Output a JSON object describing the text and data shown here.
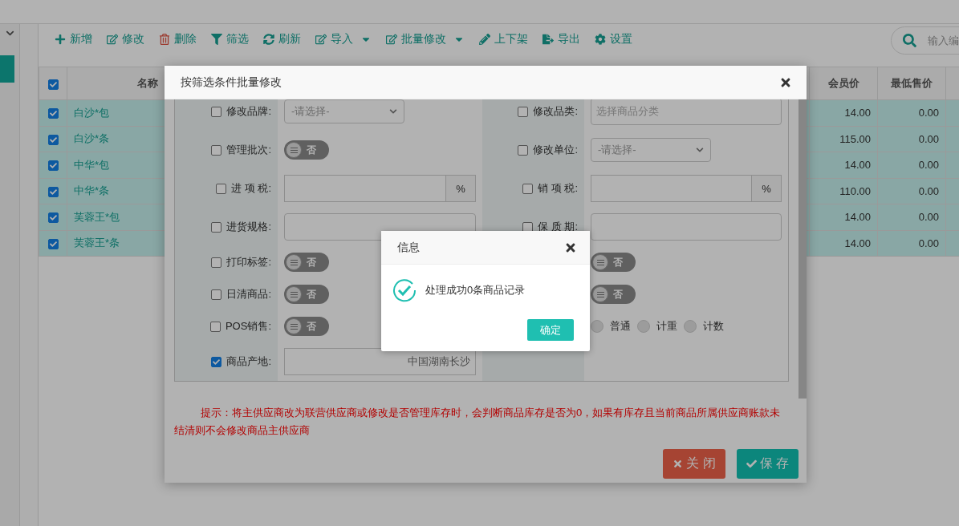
{
  "toolbar": [
    {
      "label": "新增",
      "dropdown": false
    },
    {
      "label": "修改",
      "dropdown": false
    },
    {
      "label": "删除",
      "dropdown": false
    },
    {
      "label": "筛选",
      "dropdown": false
    },
    {
      "label": "刷新",
      "dropdown": false
    },
    {
      "label": "导入",
      "dropdown": true
    },
    {
      "label": "批量修改",
      "dropdown": true
    },
    {
      "label": "上下架",
      "dropdown": false
    },
    {
      "label": "导出",
      "dropdown": false
    },
    {
      "label": "设置",
      "dropdown": false
    }
  ],
  "search": {
    "placeholder": "输入编"
  },
  "table": {
    "all_checked": true,
    "name_column": "名称",
    "columns": [
      "会员价",
      "最低售价"
    ],
    "rows": [
      {
        "checked": true,
        "name": "白沙*包",
        "values": [
          "14.00",
          "0.00"
        ]
      },
      {
        "checked": true,
        "name": "白沙*条",
        "values": [
          "115.00",
          "0.00"
        ]
      },
      {
        "checked": true,
        "name": "中华*包",
        "values": [
          "14.00",
          "0.00"
        ]
      },
      {
        "checked": true,
        "name": "中华*条",
        "values": [
          "110.00",
          "0.00"
        ]
      },
      {
        "checked": true,
        "name": "芙蓉王*包",
        "values": [
          "14.00",
          "0.00"
        ]
      },
      {
        "checked": true,
        "name": "芙蓉王*条",
        "values": [
          "14.00",
          "0.00"
        ]
      }
    ]
  },
  "dialog": {
    "title": "按筛选条件批量修改",
    "rows": [
      {
        "left": {
          "label": "修改品牌:",
          "checked": false,
          "kind": "select",
          "value": "-请选择-"
        },
        "right": {
          "label": "修改品类:",
          "checked": false,
          "kind": "input",
          "placeholder": "选择商品分类"
        }
      },
      {
        "left": {
          "label": "管理批次:",
          "checked": false,
          "kind": "toggle",
          "value": "否",
          "on": false
        },
        "right": {
          "label": "修改单位:",
          "checked": false,
          "kind": "select",
          "value": "-请选择-"
        }
      },
      {
        "left": {
          "label": "进 项 税:",
          "checked": false,
          "kind": "percent",
          "unit": "%"
        },
        "right": {
          "label": "销 项 税:",
          "checked": false,
          "kind": "percent",
          "unit": "%"
        }
      },
      {
        "left": {
          "label": "进货规格:",
          "checked": false,
          "kind": "input"
        },
        "right": {
          "label": "保 质 期:",
          "checked": false,
          "kind": "input"
        }
      },
      {
        "left": {
          "label": "打印标签:",
          "checked": false,
          "kind": "toggle",
          "value": "否",
          "on": false
        },
        "right": {
          "kind": "toggle",
          "value": "否",
          "on": false
        }
      },
      {
        "left": {
          "label": "日清商品:",
          "checked": false,
          "kind": "toggle",
          "value": "否",
          "on": false
        },
        "right": {
          "kind": "toggle",
          "value": "否",
          "on": false
        }
      },
      {
        "left": {
          "label": "POS销售:",
          "checked": false,
          "kind": "toggle",
          "value": "否",
          "on": false
        },
        "right": {
          "kind": "radios",
          "options": [
            {
              "label": "普通",
              "selected": false
            },
            {
              "label": "计重",
              "selected": false
            },
            {
              "label": "计数",
              "selected": false
            }
          ]
        }
      },
      {
        "left": {
          "label": "商品产地:",
          "checked": true,
          "kind": "text",
          "value": "中国湖南长沙"
        },
        "right": {
          "kind": "empty"
        }
      }
    ],
    "hint": "提示：将主供应商改为联营供应商或修改是否管理库存时，会判断商品库存是否为0，如果有库存且当前商品所属供应商账款未结清则不会修改商品主供应商",
    "buttons": [
      {
        "label": "关 闭",
        "kind": "close"
      },
      {
        "label": "保 存",
        "kind": "save"
      }
    ]
  },
  "message": {
    "title": "信息",
    "text": "处理成功0条商品记录",
    "button": "确定"
  }
}
